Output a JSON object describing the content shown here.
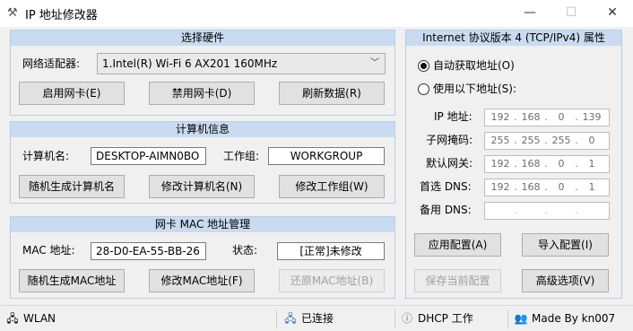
{
  "window": {
    "title": "IP 地址修改器",
    "app_icon": "tools-icon",
    "minimize": "—",
    "maximize": "☐",
    "close": "✕"
  },
  "hardware": {
    "header": "选择硬件",
    "adapter_label": "网络适配器:",
    "adapter_value": "1.Intel(R) Wi-Fi 6 AX201 160MHz",
    "btn_enable": "启用网卡(E)",
    "btn_disable": "禁用网卡(D)",
    "btn_refresh": "刷新数据(R)"
  },
  "computer": {
    "header": "计算机信息",
    "name_label": "计算机名:",
    "name_value": "DESKTOP-AIMN0BO",
    "workgroup_label": "工作组:",
    "workgroup_value": "WORKGROUP",
    "btn_random": "随机生成计算机名",
    "btn_modify_name": "修改计算机名(N)",
    "btn_modify_group": "修改工作组(W)"
  },
  "mac": {
    "header": "网卡 MAC 地址管理",
    "mac_label": "MAC 地址:",
    "mac_value": "28-D0-EA-55-BB-26",
    "status_label": "状态:",
    "status_value": "[正常]未修改",
    "btn_random": "随机生成MAC地址",
    "btn_modify": "修改MAC地址(F)",
    "btn_restore": "还原MAC地址(B)"
  },
  "ipv4": {
    "header": "Internet 协议版本 4 (TCP/IPv4) 属性",
    "radio_auto": "自动获取地址(O)",
    "radio_manual": "使用以下地址(S):",
    "auto_selected": true,
    "ip_label": "IP 地址:",
    "ip": [
      "192",
      "168",
      "0",
      "139"
    ],
    "mask_label": "子网掩码:",
    "mask": [
      "255",
      "255",
      "255",
      "0"
    ],
    "gateway_label": "默认网关:",
    "gateway": [
      "192",
      "168",
      "0",
      "1"
    ],
    "dns1_label": "首选 DNS:",
    "dns1": [
      "192",
      "168",
      "0",
      "1"
    ],
    "dns2_label": "备用 DNS:",
    "dns2": [
      "",
      "",
      "",
      ""
    ],
    "btn_apply": "应用配置(A)",
    "btn_import": "导入配置(I)",
    "btn_save": "保存当前配置",
    "btn_advanced": "高级选项(V)"
  },
  "status": {
    "network": "WLAN",
    "network_icon": "network-icon",
    "connection": "已连接",
    "connection_icon": "connected-icon",
    "dhcp": "DHCP 工作",
    "dhcp_icon": "info-icon",
    "author": "Made By kn007",
    "author_icon": "users-icon"
  }
}
